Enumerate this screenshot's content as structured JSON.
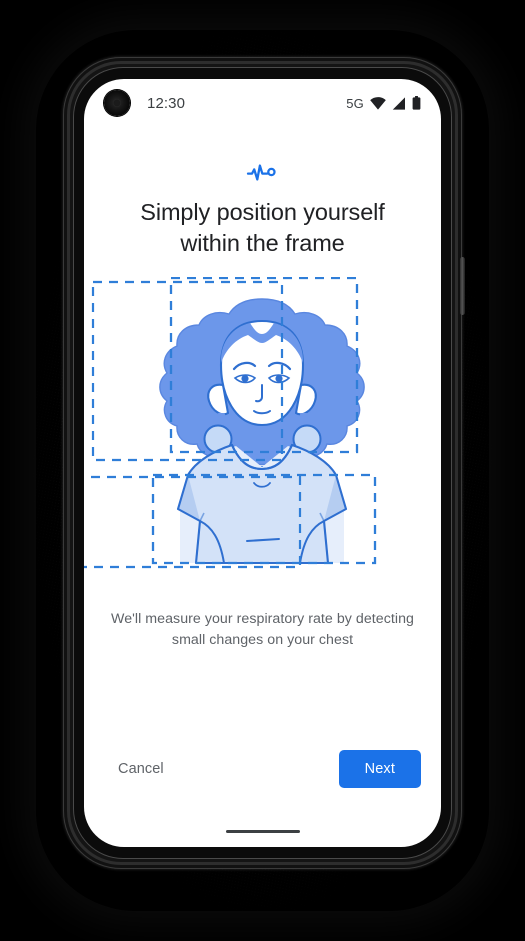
{
  "device": {
    "frame_color": "#141414",
    "screen_background": "#ffffff"
  },
  "status_bar": {
    "time": "12:30",
    "network": "5G",
    "icons": [
      "wifi-icon",
      "cellular-signal-icon",
      "battery-icon"
    ],
    "camera": "front-camera-punch-hole"
  },
  "header": {
    "icon": "vitals-pulse-icon",
    "icon_color": "#1b72e8",
    "title": "Simply position yourself within the frame"
  },
  "illustration": {
    "name": "person-in-frame-illustration",
    "alt": "Illustration of a person with curly hair, a dashed frame around the face and a dashed frame around the chest",
    "face_frame_label": "face-alignment-frame",
    "chest_frame_label": "chest-alignment-frame",
    "colors": {
      "hair": "#6c97ea",
      "outline": "#2f6fd0",
      "shirt": "#d3e2f8",
      "shirt_shadow": "#bed6f4",
      "skin": "#ffffff",
      "frame_dash": "#2f7ed8",
      "earring": "#c5daf7"
    }
  },
  "body": {
    "description": "We'll measure your respiratory rate by detecting small changes on your chest"
  },
  "actions": {
    "cancel_label": "Cancel",
    "next_label": "Next",
    "next_color": "#1b72e8"
  },
  "system": {
    "home_indicator": "gesture-home-bar"
  }
}
